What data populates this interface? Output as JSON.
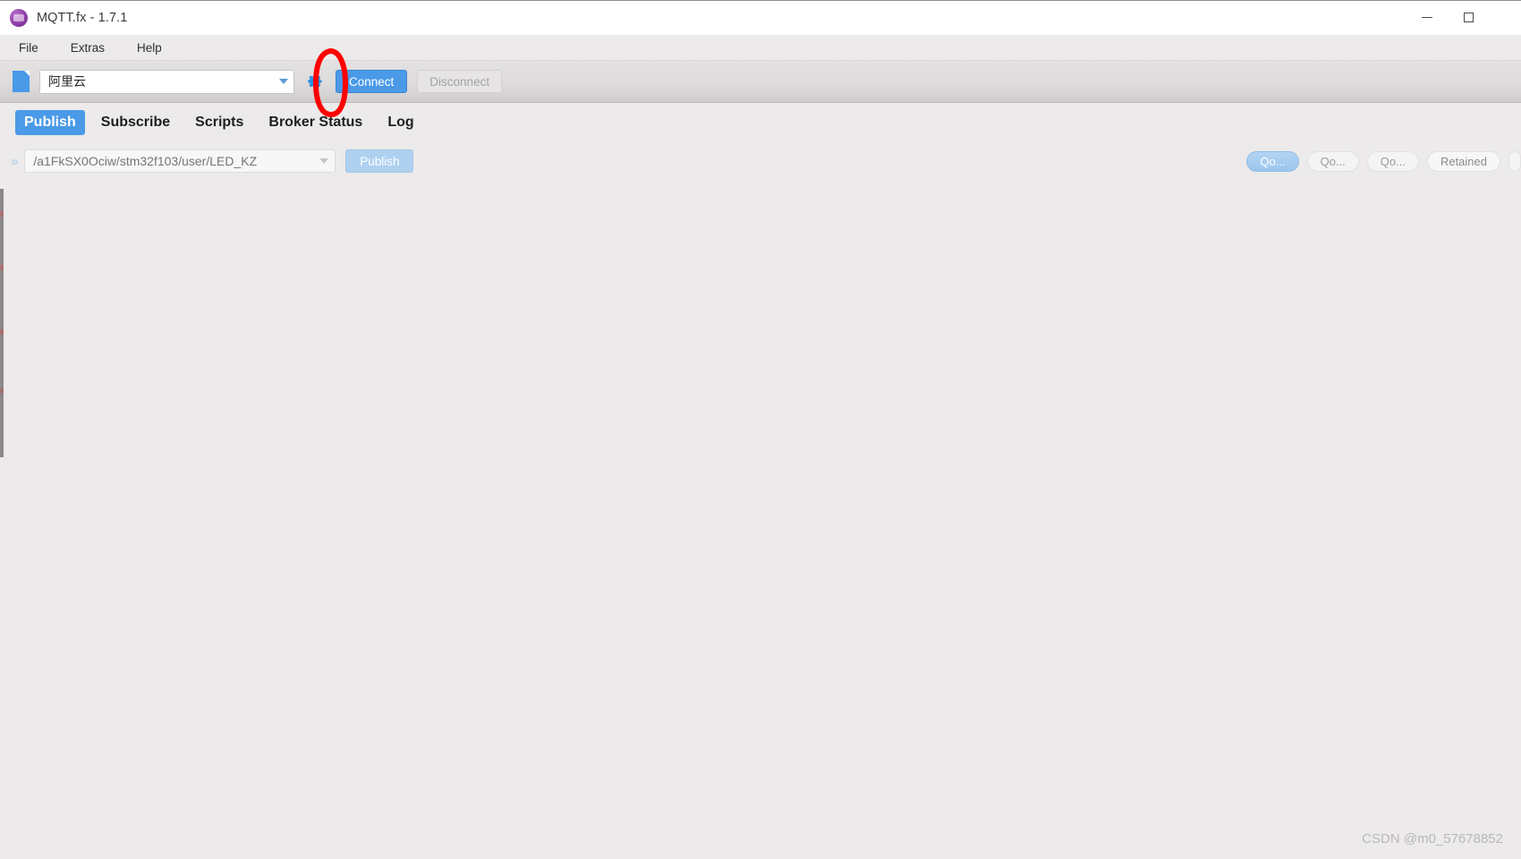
{
  "window": {
    "title": "MQTT.fx - 1.7.1",
    "app_icon": "mqtt-logo-icon",
    "controls": [
      {
        "name": "minimize-button",
        "glyph": "minimize-icon"
      },
      {
        "name": "maximize-button",
        "glyph": "maximize-icon"
      }
    ]
  },
  "menu": {
    "items": [
      {
        "label": "File"
      },
      {
        "label": "Extras"
      },
      {
        "label": "Help"
      }
    ]
  },
  "toolbar": {
    "file_icon": "broker-file-icon",
    "profile": {
      "value": "阿里云",
      "caret_icon": "chevron-down-icon"
    },
    "gear_icon": "gear-icon",
    "connect_label": "Connect",
    "disconnect_label": "Disconnect"
  },
  "tabs": [
    {
      "label": "Publish",
      "active": true
    },
    {
      "label": "Subscribe",
      "active": false
    },
    {
      "label": "Scripts",
      "active": false
    },
    {
      "label": "Broker Status",
      "active": false
    },
    {
      "label": "Log",
      "active": false
    }
  ],
  "publish": {
    "expand_icon": "double-chevron-right-icon",
    "topic_placeholder": "/a1FkSX0Ociw/stm32f103/user/LED_KZ",
    "topic_value": "",
    "topic_caret_icon": "chevron-down-icon",
    "publish_label": "Publish",
    "options": [
      {
        "label": "Qo...",
        "name": "qos-0-button",
        "selected": true
      },
      {
        "label": "Qo...",
        "name": "qos-1-button",
        "selected": false
      },
      {
        "label": "Qo...",
        "name": "qos-2-button",
        "selected": false
      },
      {
        "label": "Retained",
        "name": "retained-button",
        "selected": false
      }
    ]
  },
  "annotation": {
    "shape": "red-ellipse-highlight",
    "color": "#fe0000",
    "target": "gear-icon"
  },
  "watermark": {
    "text": "CSDN @m0_57678852"
  },
  "colors": {
    "accent": "#4a9ae8",
    "window_bg": "#eceaea",
    "titlebar_bg": "#ffffff",
    "annotation_red": "#fe0000"
  }
}
